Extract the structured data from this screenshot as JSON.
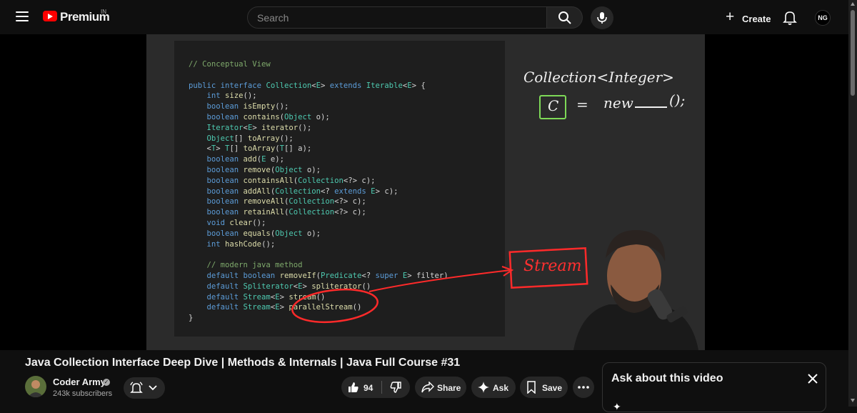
{
  "header": {
    "brand": "Premium",
    "country": "IN",
    "search_placeholder": "Search",
    "create_label": "Create",
    "avatar_initials": "NG"
  },
  "video": {
    "code_lines": [
      [
        {
          "t": "// Conceptual View",
          "c": "cm"
        }
      ],
      [],
      [
        {
          "t": "public interface ",
          "c": "kw"
        },
        {
          "t": "Collection",
          "c": "ty"
        },
        {
          "t": "<",
          "c": ""
        },
        {
          "t": "E",
          "c": "ty"
        },
        {
          "t": "> ",
          "c": ""
        },
        {
          "t": "extends ",
          "c": "kw"
        },
        {
          "t": "Iterable",
          "c": "ty"
        },
        {
          "t": "<",
          "c": ""
        },
        {
          "t": "E",
          "c": "ty"
        },
        {
          "t": "> {",
          "c": ""
        }
      ],
      [
        {
          "t": "    int ",
          "c": "kw"
        },
        {
          "t": "size",
          "c": "fn"
        },
        {
          "t": "();",
          "c": ""
        }
      ],
      [
        {
          "t": "    boolean ",
          "c": "kw"
        },
        {
          "t": "isEmpty",
          "c": "fn"
        },
        {
          "t": "();",
          "c": ""
        }
      ],
      [
        {
          "t": "    boolean ",
          "c": "kw"
        },
        {
          "t": "contains",
          "c": "fn"
        },
        {
          "t": "(",
          "c": ""
        },
        {
          "t": "Object",
          "c": "ty"
        },
        {
          "t": " o);",
          "c": ""
        }
      ],
      [
        {
          "t": "    Iterator",
          "c": "ty"
        },
        {
          "t": "<",
          "c": ""
        },
        {
          "t": "E",
          "c": "ty"
        },
        {
          "t": "> ",
          "c": ""
        },
        {
          "t": "iterator",
          "c": "fn"
        },
        {
          "t": "();",
          "c": ""
        }
      ],
      [
        {
          "t": "    Object",
          "c": "ty"
        },
        {
          "t": "[] ",
          "c": ""
        },
        {
          "t": "toArray",
          "c": "fn"
        },
        {
          "t": "();",
          "c": ""
        }
      ],
      [
        {
          "t": "    <",
          "c": ""
        },
        {
          "t": "T",
          "c": "ty"
        },
        {
          "t": "> ",
          "c": ""
        },
        {
          "t": "T",
          "c": "ty"
        },
        {
          "t": "[] ",
          "c": ""
        },
        {
          "t": "toArray",
          "c": "fn"
        },
        {
          "t": "(",
          "c": ""
        },
        {
          "t": "T",
          "c": "ty"
        },
        {
          "t": "[] a);",
          "c": ""
        }
      ],
      [
        {
          "t": "    boolean ",
          "c": "kw"
        },
        {
          "t": "add",
          "c": "fn"
        },
        {
          "t": "(",
          "c": ""
        },
        {
          "t": "E",
          "c": "ty"
        },
        {
          "t": " e);",
          "c": ""
        }
      ],
      [
        {
          "t": "    boolean ",
          "c": "kw"
        },
        {
          "t": "remove",
          "c": "fn"
        },
        {
          "t": "(",
          "c": ""
        },
        {
          "t": "Object",
          "c": "ty"
        },
        {
          "t": " o);",
          "c": ""
        }
      ],
      [
        {
          "t": "    boolean ",
          "c": "kw"
        },
        {
          "t": "containsAll",
          "c": "fn"
        },
        {
          "t": "(",
          "c": ""
        },
        {
          "t": "Collection",
          "c": "ty"
        },
        {
          "t": "<?> c);",
          "c": ""
        }
      ],
      [
        {
          "t": "    boolean ",
          "c": "kw"
        },
        {
          "t": "addAll",
          "c": "fn"
        },
        {
          "t": "(",
          "c": ""
        },
        {
          "t": "Collection",
          "c": "ty"
        },
        {
          "t": "<? ",
          "c": ""
        },
        {
          "t": "extends ",
          "c": "kw"
        },
        {
          "t": "E",
          "c": "ty"
        },
        {
          "t": "> c);",
          "c": ""
        }
      ],
      [
        {
          "t": "    boolean ",
          "c": "kw"
        },
        {
          "t": "removeAll",
          "c": "fn"
        },
        {
          "t": "(",
          "c": ""
        },
        {
          "t": "Collection",
          "c": "ty"
        },
        {
          "t": "<?> c);",
          "c": ""
        }
      ],
      [
        {
          "t": "    boolean ",
          "c": "kw"
        },
        {
          "t": "retainAll",
          "c": "fn"
        },
        {
          "t": "(",
          "c": ""
        },
        {
          "t": "Collection",
          "c": "ty"
        },
        {
          "t": "<?> c);",
          "c": ""
        }
      ],
      [
        {
          "t": "    void ",
          "c": "kw"
        },
        {
          "t": "clear",
          "c": "fn"
        },
        {
          "t": "();",
          "c": ""
        }
      ],
      [
        {
          "t": "    boolean ",
          "c": "kw"
        },
        {
          "t": "equals",
          "c": "fn"
        },
        {
          "t": "(",
          "c": ""
        },
        {
          "t": "Object",
          "c": "ty"
        },
        {
          "t": " o);",
          "c": ""
        }
      ],
      [
        {
          "t": "    int ",
          "c": "kw"
        },
        {
          "t": "hashCode",
          "c": "fn"
        },
        {
          "t": "();",
          "c": ""
        }
      ],
      [],
      [
        {
          "t": "    // modern java method",
          "c": "cm"
        }
      ],
      [
        {
          "t": "    default boolean ",
          "c": "kw"
        },
        {
          "t": "removeIf",
          "c": "fn"
        },
        {
          "t": "(",
          "c": ""
        },
        {
          "t": "Predicate",
          "c": "ty"
        },
        {
          "t": "<? ",
          "c": ""
        },
        {
          "t": "super ",
          "c": "kw"
        },
        {
          "t": "E",
          "c": "ty"
        },
        {
          "t": "> filter)",
          "c": ""
        }
      ],
      [
        {
          "t": "    default ",
          "c": "kw"
        },
        {
          "t": "Spliterator",
          "c": "ty"
        },
        {
          "t": "<",
          "c": ""
        },
        {
          "t": "E",
          "c": "ty"
        },
        {
          "t": "> ",
          "c": ""
        },
        {
          "t": "spliterator",
          "c": "fn"
        },
        {
          "t": "()",
          "c": ""
        }
      ],
      [
        {
          "t": "    default ",
          "c": "kw"
        },
        {
          "t": "Stream",
          "c": "ty"
        },
        {
          "t": "<",
          "c": ""
        },
        {
          "t": "E",
          "c": "ty"
        },
        {
          "t": "> ",
          "c": ""
        },
        {
          "t": "stream",
          "c": "fn"
        },
        {
          "t": "()",
          "c": ""
        }
      ],
      [
        {
          "t": "    default ",
          "c": "kw"
        },
        {
          "t": "Stream",
          "c": "ty"
        },
        {
          "t": "<",
          "c": ""
        },
        {
          "t": "E",
          "c": "ty"
        },
        {
          "t": "> ",
          "c": ""
        },
        {
          "t": "parallelStream",
          "c": "fn"
        },
        {
          "t": "()",
          "c": ""
        }
      ],
      [
        {
          "t": "}",
          "c": ""
        }
      ]
    ],
    "annotation_top": "Collection<Integer>",
    "annotation_c": "C",
    "annotation_eq": "=",
    "annotation_new": "new",
    "annotation_tail": "();",
    "annotation_stream": "Stream"
  },
  "details": {
    "title": "Java Collection Interface Deep Dive | Methods & Internals | Java Full Course #31",
    "channel_name": "Coder Army",
    "subscribers": "243k subscribers",
    "like_count": "94",
    "share_label": "Share",
    "ask_label": "Ask",
    "save_label": "Save"
  },
  "ask_panel": {
    "title": "Ask about this video"
  }
}
